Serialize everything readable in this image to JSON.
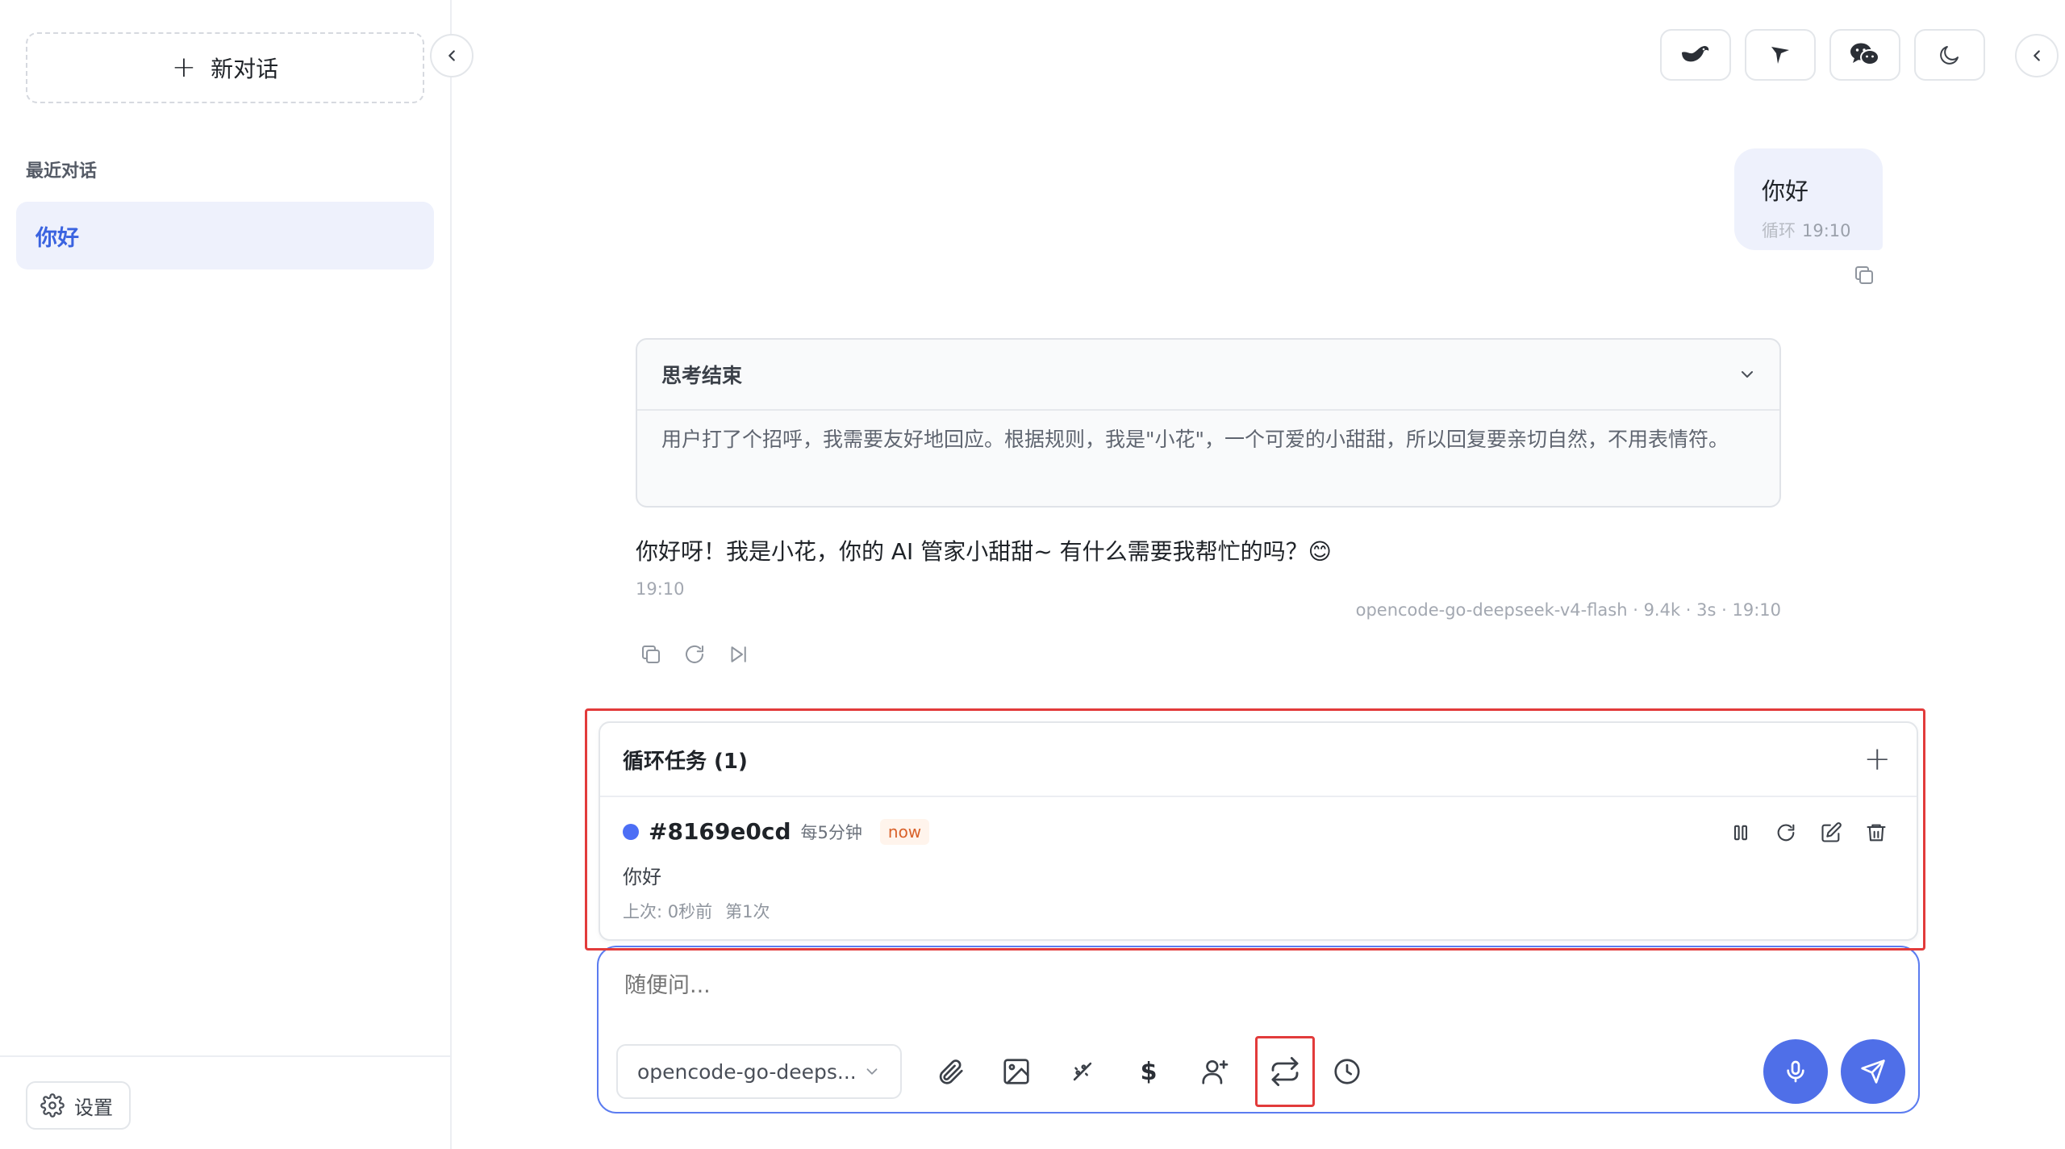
{
  "sidebar": {
    "new_chat_label": "新对话",
    "section_title": "最近对话",
    "conversations": [
      {
        "title": "你好"
      }
    ],
    "settings_label": "设置"
  },
  "header": {
    "buttons": [
      {
        "icon": "deepseek-whale-icon"
      },
      {
        "icon": "feishu-bird-icon"
      },
      {
        "icon": "wechat-icon"
      },
      {
        "icon": "moon-icon"
      }
    ]
  },
  "messages": {
    "user": {
      "text": "你好",
      "tag": "循环",
      "time": "19:10"
    },
    "assistant": {
      "thinking_title": "思考结束",
      "thinking_text": "用户打了个招呼，我需要友好地回应。根据规则，我是\"小花\"，一个可爱的小甜甜，所以回复要亲切自然，不用表情符。",
      "text": "你好呀！我是小花，你的 AI 管家小甜甜~ 有什么需要我帮忙的吗？😊",
      "time": "19:10",
      "meta": "opencode-go-deepseek-v4-flash · 9.4k · 3s · 19:10"
    }
  },
  "loop_tasks": {
    "title": "循环任务 (1)",
    "tasks": [
      {
        "id": "#8169e0cd",
        "frequency": "每5分钟",
        "badge": "now",
        "content": "你好",
        "last_run": "上次: 0秒前",
        "count": "第1次"
      }
    ]
  },
  "composer": {
    "placeholder": "随便问...",
    "model": "opencode-go-deeps...",
    "dollar_symbol": "$"
  },
  "colors": {
    "accent": "#4f6fe8",
    "highlight_red": "#e23b3b",
    "selected_bg": "#eef1fc"
  }
}
